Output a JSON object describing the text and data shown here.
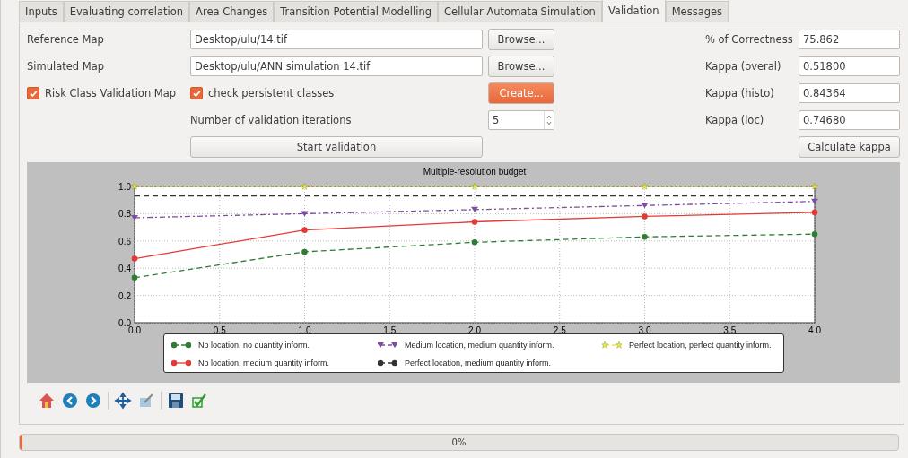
{
  "tabs": [
    {
      "label": "Inputs",
      "selected": false
    },
    {
      "label": "Evaluating correlation",
      "selected": false
    },
    {
      "label": "Area Changes",
      "selected": false
    },
    {
      "label": "Transition Potential Modelling",
      "selected": false
    },
    {
      "label": "Cellular Automata Simulation",
      "selected": false
    },
    {
      "label": "Validation",
      "selected": true
    },
    {
      "label": "Messages",
      "selected": false
    }
  ],
  "reference_map": {
    "label": "Reference Map",
    "value": "Desktop/ulu/14.tif",
    "button": "Browse..."
  },
  "simulated_map": {
    "label": "Simulated Map",
    "value": "Desktop/ulu/ANN simulation 14.tif",
    "button": "Browse..."
  },
  "risk_class_validation_map": {
    "label": "Risk Class Validation Map",
    "checked": true
  },
  "check_persistent_classes": {
    "label": "check persistent classes",
    "checked": true
  },
  "create_button": "Create...",
  "iterations": {
    "label": "Number of validation iterations",
    "value": "5"
  },
  "start_button": "Start validation",
  "results": [
    {
      "label": "% of Correctness",
      "value": "75.862"
    },
    {
      "label": "Kappa (overal)",
      "value": "0.51800"
    },
    {
      "label": "Kappa (histo)",
      "value": "0.84364"
    },
    {
      "label": "Kappa (loc)",
      "value": "0.74680"
    }
  ],
  "calculate_button": "Calculate kappa",
  "chart": {
    "chart_data": {
      "type": "line",
      "title": "Multiple-resolution budget",
      "grid": true,
      "x": [
        0,
        1,
        2,
        3,
        4
      ],
      "xlim": [
        0,
        4
      ],
      "ylim": [
        0,
        1
      ],
      "xticks": [
        {
          "value": 0,
          "label": "0.0"
        },
        {
          "value": 0.5,
          "label": "0.5"
        },
        {
          "value": 1,
          "label": "1.0"
        },
        {
          "value": 1.5,
          "label": "1.5"
        },
        {
          "value": 2,
          "label": "2.0"
        },
        {
          "value": 2.5,
          "label": "2.5"
        },
        {
          "value": 3,
          "label": "3.0"
        },
        {
          "value": 3.5,
          "label": "3.5"
        },
        {
          "value": 4,
          "label": "4.0"
        }
      ],
      "yticks": [
        {
          "value": 0,
          "label": "0.0"
        },
        {
          "value": 0.2,
          "label": "0.2"
        },
        {
          "value": 0.4,
          "label": "0.4"
        },
        {
          "value": 0.6,
          "label": "0.6"
        },
        {
          "value": 0.8,
          "label": "0.8"
        },
        {
          "value": 1,
          "label": "1.0"
        }
      ],
      "series": [
        {
          "name": "No location, no quantity inform.",
          "color": "#2e7d32",
          "line_style": "dashed",
          "marker": "circle",
          "values": [
            0.33,
            0.52,
            0.59,
            0.63,
            0.65
          ]
        },
        {
          "name": "No location, medium quantity inform.",
          "color": "#e53935",
          "line_style": "solid",
          "marker": "circle",
          "values": [
            0.47,
            0.68,
            0.74,
            0.78,
            0.81
          ]
        },
        {
          "name": "Medium location, medium quantity inform.",
          "color": "#7b4f9e",
          "line_style": "dashdot",
          "marker": "triangle",
          "values": [
            0.77,
            0.8,
            0.83,
            0.86,
            0.89
          ]
        },
        {
          "name": "Perfect location, medium quantity inform.",
          "color": "#333333",
          "line_style": "dashed",
          "marker": "none",
          "values": [
            0.93,
            0.93,
            0.93,
            0.93,
            0.93
          ]
        },
        {
          "name": "Perfect location, perfect quantity inform.",
          "color": "#e8e84a",
          "line_style": "dotted",
          "marker": "star",
          "values": [
            1,
            1,
            1,
            1,
            1
          ]
        }
      ]
    }
  },
  "progress": {
    "level": 0,
    "text": "0%"
  }
}
